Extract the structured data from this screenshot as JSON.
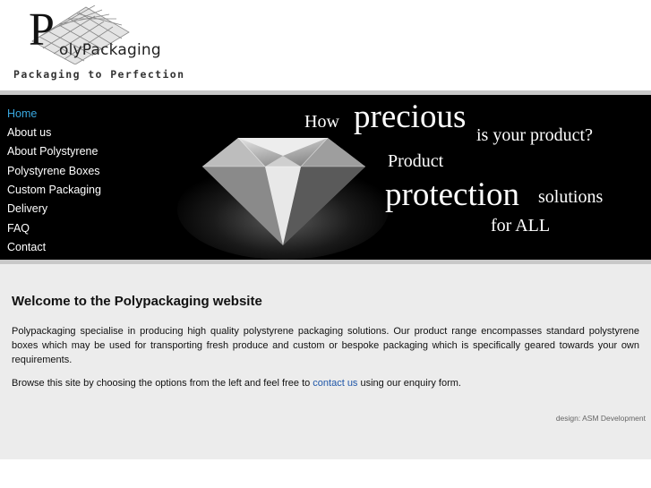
{
  "logo": {
    "big_letter": "P",
    "name": "olyPackaging",
    "tagline": "Packaging to Perfection"
  },
  "nav": {
    "items": [
      {
        "label": "Home",
        "active": true
      },
      {
        "label": "About us"
      },
      {
        "label": "About Polystyrene"
      },
      {
        "label": "Polystyrene Boxes"
      },
      {
        "label": "Custom Packaging"
      },
      {
        "label": "Delivery"
      },
      {
        "label": "FAQ"
      },
      {
        "label": "Contact"
      }
    ]
  },
  "banner": {
    "how": "How",
    "precious": "precious",
    "your_product": "is your product?",
    "product": "Product",
    "protection": "protection",
    "solutions": "solutions",
    "for_all": "for ALL"
  },
  "content": {
    "heading": "Welcome to the Polypackaging website",
    "paragraph1": "Polypackaging specialise in producing high quality polystyrene packaging solutions. Our product range encompasses standard polystyrene boxes which may be used for transporting fresh produce and custom or bespoke packaging which is specifically geared towards your own requirements.",
    "paragraph2_before": "Browse this site by choosing the options from the left and feel free to ",
    "paragraph2_link": "contact us",
    "paragraph2_after": " using our enquiry form.",
    "credit": "design: ASM Development"
  },
  "colors": {
    "banner_bg": "#000000",
    "nav_active": "#39a8e0",
    "link": "#1e56a8",
    "content_bg": "#ececec",
    "border_gray": "#c8c8c8"
  },
  "icons": [
    "logo-mesh-graphic",
    "diamond-image"
  ]
}
